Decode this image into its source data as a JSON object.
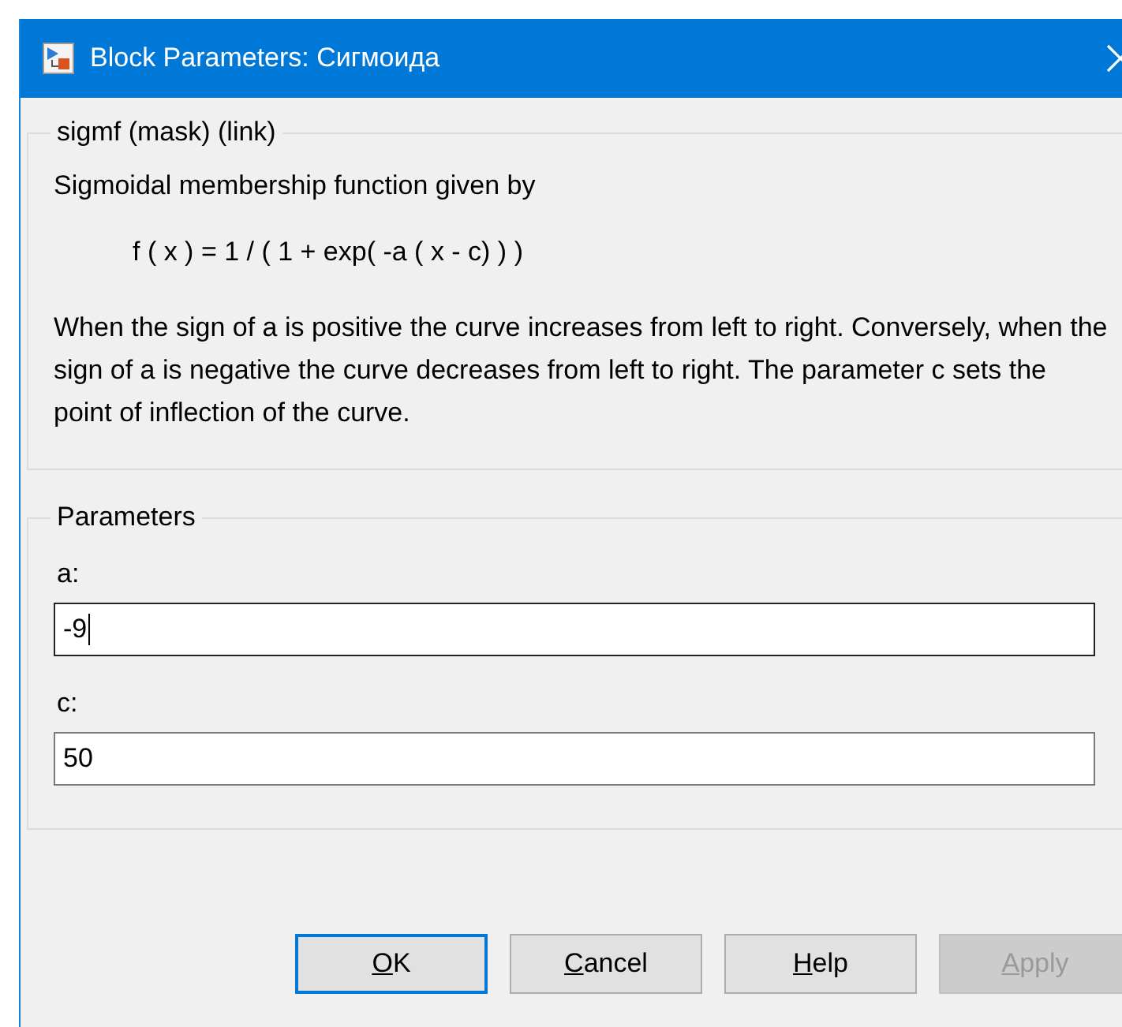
{
  "window": {
    "title": "Block Parameters: Сигмоида"
  },
  "description": {
    "legend": "sigmf (mask) (link)",
    "intro": "Sigmoidal membership function given by",
    "formula": "f ( x ) = 1 / ( 1 + exp( -a ( x - c) ) )",
    "paragraph": "When the sign of a is positive the curve increases from left to right. Conversely, when the sign of a is negative the curve decreases from left to right. The parameter c sets the point of inflection of the curve."
  },
  "parameters": {
    "legend": "Parameters",
    "fields": [
      {
        "label": "a:",
        "value": "-9",
        "focused": true
      },
      {
        "label": "c:",
        "value": "50",
        "focused": false
      }
    ]
  },
  "buttons": [
    {
      "mnemonic": "O",
      "rest": "K",
      "focused": true,
      "disabled": false
    },
    {
      "mnemonic": "C",
      "rest": "ancel",
      "focused": false,
      "disabled": false
    },
    {
      "mnemonic": "H",
      "rest": "elp",
      "focused": false,
      "disabled": false
    },
    {
      "mnemonic": "A",
      "rest": "pply",
      "focused": false,
      "disabled": true
    }
  ]
}
